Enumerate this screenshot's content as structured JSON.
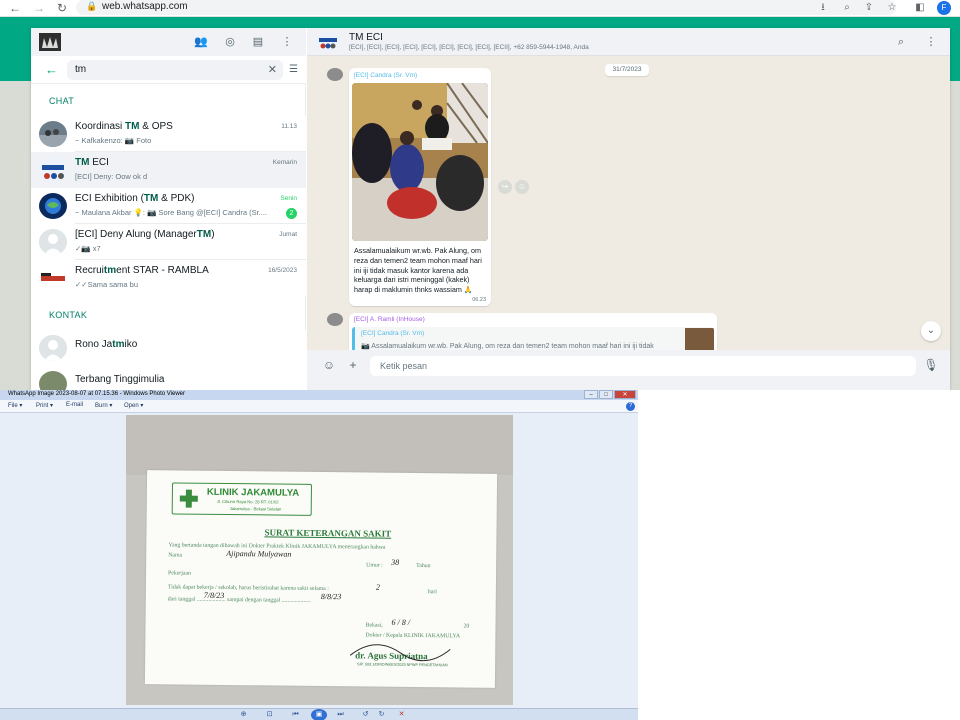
{
  "browser": {
    "url": "web.whatsapp.com",
    "profile_initial": "F"
  },
  "whatsapp": {
    "search": {
      "value": "tm"
    },
    "sections": {
      "chats": "CHAT",
      "contacts": "KONTAK"
    },
    "chats": [
      {
        "name_pre": "Koordinasi ",
        "name_match": "TM",
        "name_post": " &  OPS",
        "time": "11.13",
        "message": "~ Kafkakenzo: 📷 Foto"
      },
      {
        "name_pre": "",
        "name_match": "TM",
        "name_post": " ECI",
        "time": "Kemarin",
        "message": "[ECI] Deny: Oow ok d"
      },
      {
        "name_pre": "ECI Exhibition (",
        "name_match": "TM",
        "name_post": " & PDK)",
        "time": "Senin",
        "message": "~ Maulana Akbar 💡: 📷 Sore Bang @[ECI] Candra (Sr....",
        "badge": "2"
      },
      {
        "name_pre": "[ECI] Deny Alung (Manager",
        "name_match": "TM",
        "name_post": ")",
        "time": "Jumat",
        "message": "✓📷 x7"
      },
      {
        "name_pre": "Recrui",
        "name_match": "tm",
        "name_post": "ent STAR - RAMBLA",
        "time": "16/5/2023",
        "message": "✓✓Sama sama bu"
      }
    ],
    "contacts": [
      {
        "name_pre": "Rono Ja",
        "name_match": "tm",
        "name_post": "iko"
      },
      {
        "name_pre": "Terbang Tinggimulia",
        "name_match": "",
        "name_post": ""
      }
    ],
    "conversation": {
      "title": "TM ECI",
      "participants": "[ECI], [ECI], [ECI], [ECI], [ECI], [ECI], [ECI], [ECI], [ECII], +62 859-5944-1948, Anda",
      "date_chip": "31/7/2023",
      "message1": {
        "sender": "[ECI] Candra (Sr. Vm)",
        "caption": "Assalamualaikum wr.wb. Pak Alung, om reza dan temen2 team mohon maaf hari ini iji tidak masuk kantor karena ada keluarga dari istri meninggal (kakek) harap di maklumin thnks wassiam 🙏",
        "time": "06.23"
      },
      "message2": {
        "sender": "[ECI] A. Ramli (InHouse)",
        "quoted_sender": "[ECI] Candra (Sr. Vm)",
        "quoted_text": "📷 Assalamualaikum wr.wb. Pak Alung,  om reza dan temen2 team mohon maaf hari ini iji tidak"
      },
      "input_placeholder": "Ketik pesan"
    }
  },
  "photo_viewer": {
    "window_title": "WhatsApp Image 2023-08-07 at 07.15.36 - Windows Photo Viewer",
    "menu": [
      "File ▾",
      "Print ▾",
      "E-mail",
      "Burn ▾",
      "Open ▾"
    ],
    "certificate": {
      "clinic_name": "KLINIK JAKAMULYA",
      "clinic_address": "Jl. Cikunir Raya No. 28 RT. 01/02",
      "clinic_area": "Jakamulya - Bekasi Selatan",
      "title": "SURAT KETERANGAN SAKIT",
      "line1": "Yang bertanda tangan dibawah ini Dokter Praktek Klinik JAKAMULYA menerangkan bahwa",
      "label_name": "Nama",
      "label_age": "Umur :",
      "label_years": "Tahun",
      "label_job": "Pekerjaan",
      "line_rest": "Tidak dapat bekerja / sekolah, harus beristirahat karena sakit selama :",
      "label_days": "hari",
      "line_dates": "dari tanggal .................... sampai dengan tanggal ....................",
      "place_date": "Bekasi,",
      "year": "20",
      "doctor_label": "Dokter / Kepala KLINIK JAKAMULYA",
      "doctor_name": "dr. Agus Supriatna",
      "doctor_sub": "SIP. 503.1/DR/DINKES/2023 NPWP PENGETAHUAN",
      "hand_name": "Ajipandu Mulyawan",
      "hand_age": "38",
      "hand_days": "2",
      "hand_from": "7/8/23",
      "hand_to": "8/8/23",
      "hand_date": "6 / 8 /"
    }
  }
}
